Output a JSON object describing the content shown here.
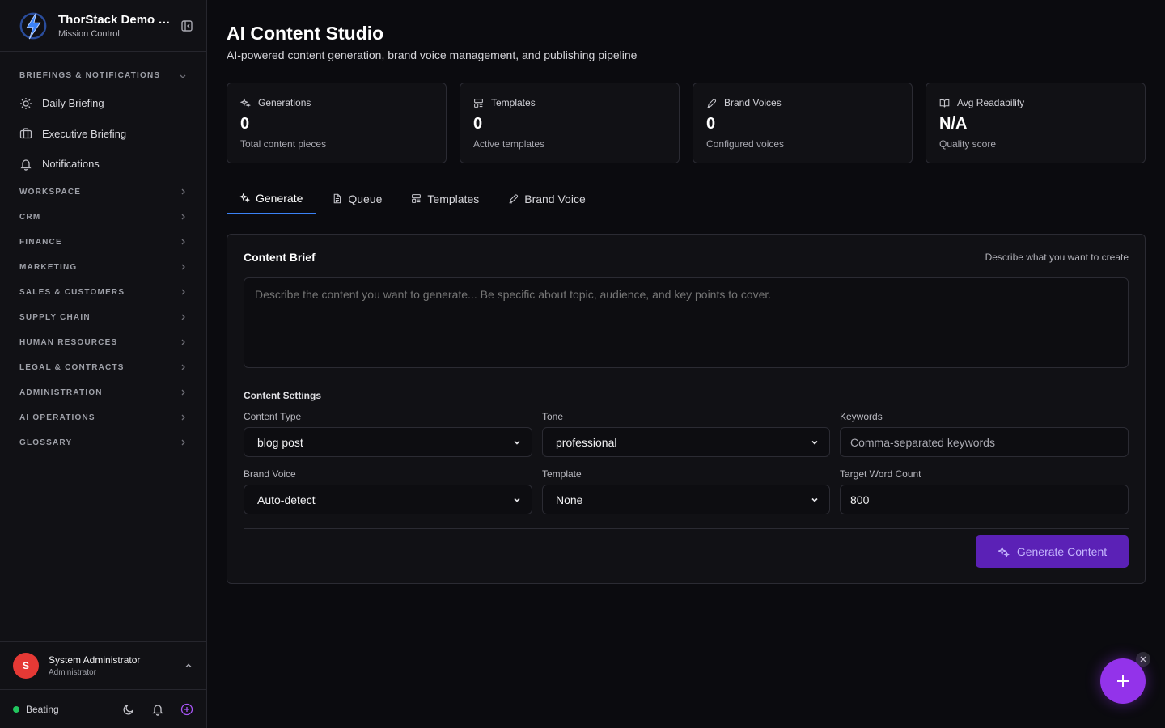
{
  "app": {
    "name": "ThorStack Demo C…",
    "subtitle": "Mission Control"
  },
  "sidebar": {
    "sections": [
      {
        "label": "BRIEFINGS & NOTIFICATIONS",
        "expanded": true,
        "items": [
          {
            "label": "Daily Briefing",
            "icon": "sun-icon"
          },
          {
            "label": "Executive Briefing",
            "icon": "briefcase-icon"
          },
          {
            "label": "Notifications",
            "icon": "bell-icon"
          }
        ]
      },
      {
        "label": "WORKSPACE"
      },
      {
        "label": "CRM"
      },
      {
        "label": "FINANCE"
      },
      {
        "label": "MARKETING"
      },
      {
        "label": "SALES & CUSTOMERS"
      },
      {
        "label": "SUPPLY CHAIN"
      },
      {
        "label": "HUMAN RESOURCES"
      },
      {
        "label": "LEGAL & CONTRACTS"
      },
      {
        "label": "ADMINISTRATION"
      },
      {
        "label": "AI OPERATIONS"
      },
      {
        "label": "GLOSSARY"
      }
    ]
  },
  "user": {
    "initial": "S",
    "name": "System Administrator",
    "role": "Administrator",
    "avatar_color": "#e53935"
  },
  "status": {
    "label": "Beating",
    "color": "#22c55e"
  },
  "page": {
    "title": "AI Content Studio",
    "subtitle": "AI-powered content generation, brand voice management, and publishing pipeline"
  },
  "stats": [
    {
      "label": "Generations",
      "value": "0",
      "sub": "Total content pieces",
      "icon": "sparkles-icon"
    },
    {
      "label": "Templates",
      "value": "0",
      "sub": "Active templates",
      "icon": "template-icon"
    },
    {
      "label": "Brand Voices",
      "value": "0",
      "sub": "Configured voices",
      "icon": "pen-icon"
    },
    {
      "label": "Avg Readability",
      "value": "N/A",
      "sub": "Quality score",
      "icon": "book-icon"
    }
  ],
  "tabs": [
    {
      "label": "Generate",
      "active": true,
      "icon": "sparkles-icon"
    },
    {
      "label": "Queue",
      "active": false,
      "icon": "document-icon"
    },
    {
      "label": "Templates",
      "active": false,
      "icon": "template-icon"
    },
    {
      "label": "Brand Voice",
      "active": false,
      "icon": "pen-icon"
    }
  ],
  "brief": {
    "title": "Content Brief",
    "hint": "Describe what you want to create",
    "placeholder": "Describe the content you want to generate... Be specific about topic, audience, and key points to cover."
  },
  "settings": {
    "title": "Content Settings",
    "content_type": {
      "label": "Content Type",
      "value": "blog post"
    },
    "tone": {
      "label": "Tone",
      "value": "professional"
    },
    "keywords": {
      "label": "Keywords",
      "placeholder": "Comma-separated keywords"
    },
    "brand_voice": {
      "label": "Brand Voice",
      "value": "Auto-detect"
    },
    "template": {
      "label": "Template",
      "value": "None"
    },
    "word_count": {
      "label": "Target Word Count",
      "value": "800"
    }
  },
  "actions": {
    "generate_label": "Generate Content"
  },
  "colors": {
    "accent": "#9333ea",
    "tab_indicator": "#3b82f6",
    "button_bg": "#5b21b6"
  }
}
